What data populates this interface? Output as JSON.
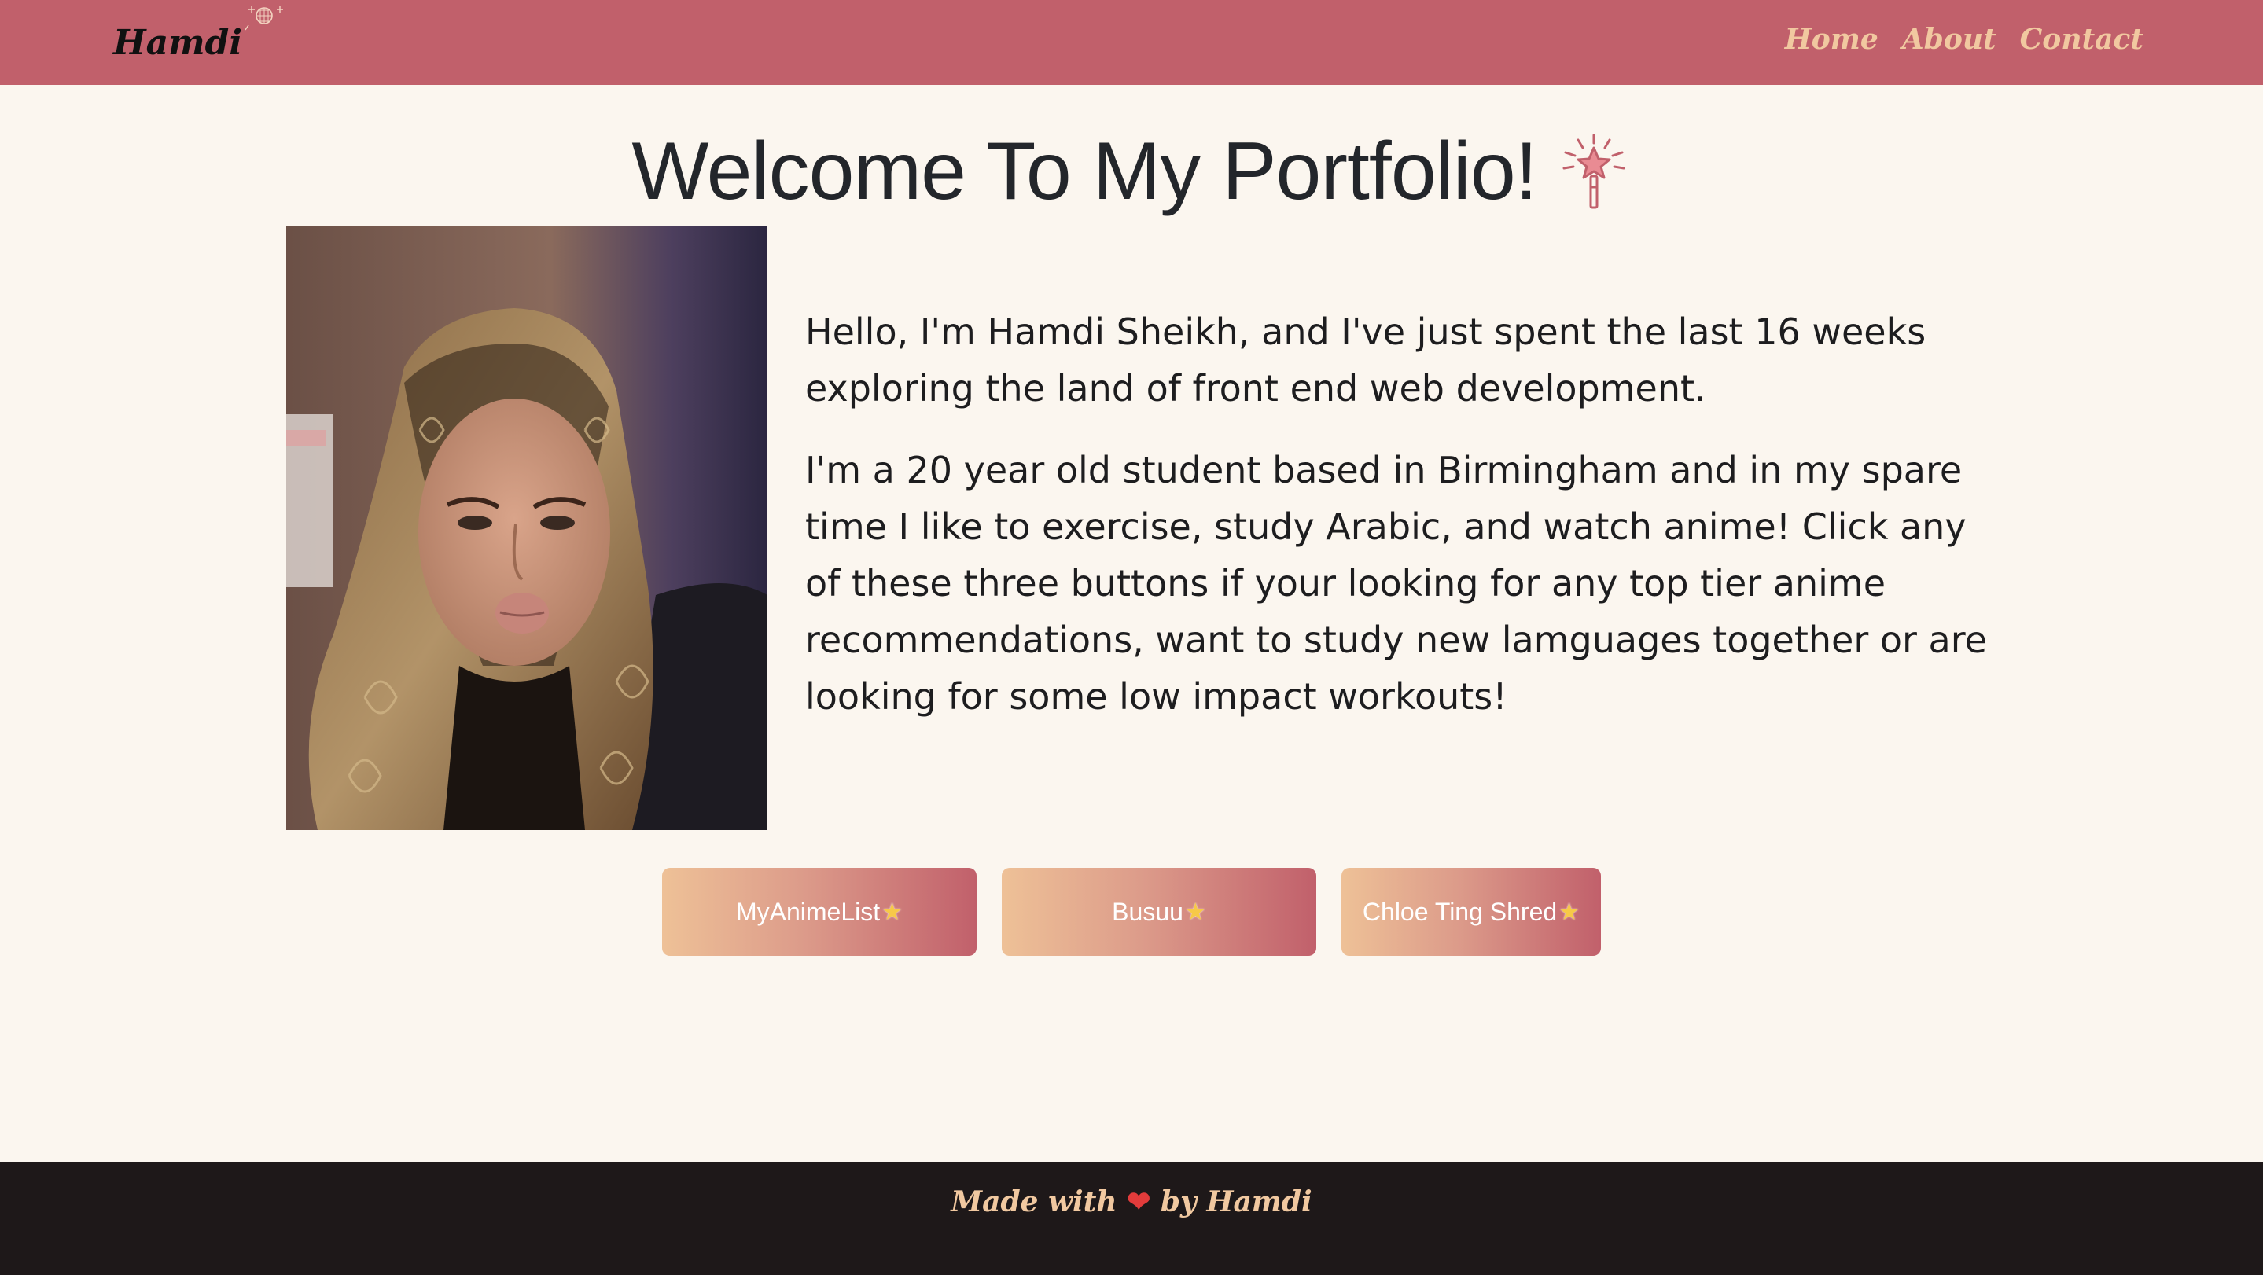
{
  "nav": {
    "brand": "Hamdi",
    "brand_icon": "disco-ball-icon",
    "links": [
      "Home",
      "About",
      "Contact"
    ]
  },
  "hero": {
    "title": "Welcome To My Portfolio!",
    "title_icon": "magic-wand-icon"
  },
  "profile": {
    "photo": "profile-photo",
    "paragraphs": [
      "Hello, I'm Hamdi Sheikh, and I've just spent the last 16 weeks exploring the land of front end web development.",
      "I'm a 20 year old student based in Birmingham and in my spare time I like to exercise, study Arabic, and watch anime! Click any of these three buttons if your looking for any top tier anime recommendations, want to study new lamguages together or are looking for some low impact workouts!"
    ]
  },
  "buttons": [
    {
      "label": "MyAnimeList",
      "icon": "star-icon"
    },
    {
      "label": "Busuu",
      "icon": "star-icon"
    },
    {
      "label": "Chloe Ting Shred",
      "icon": "star-icon"
    }
  ],
  "footer": {
    "prefix": "Made with",
    "heart": "❤",
    "suffix": "by Hamdi"
  },
  "colors": {
    "navbar": "#c1606b",
    "nav_link": "#f1c8a0",
    "background": "#fbf6ef",
    "footer": "#1e1819",
    "button_gradient_start": "#eec197",
    "button_gradient_end": "#c1606b"
  }
}
